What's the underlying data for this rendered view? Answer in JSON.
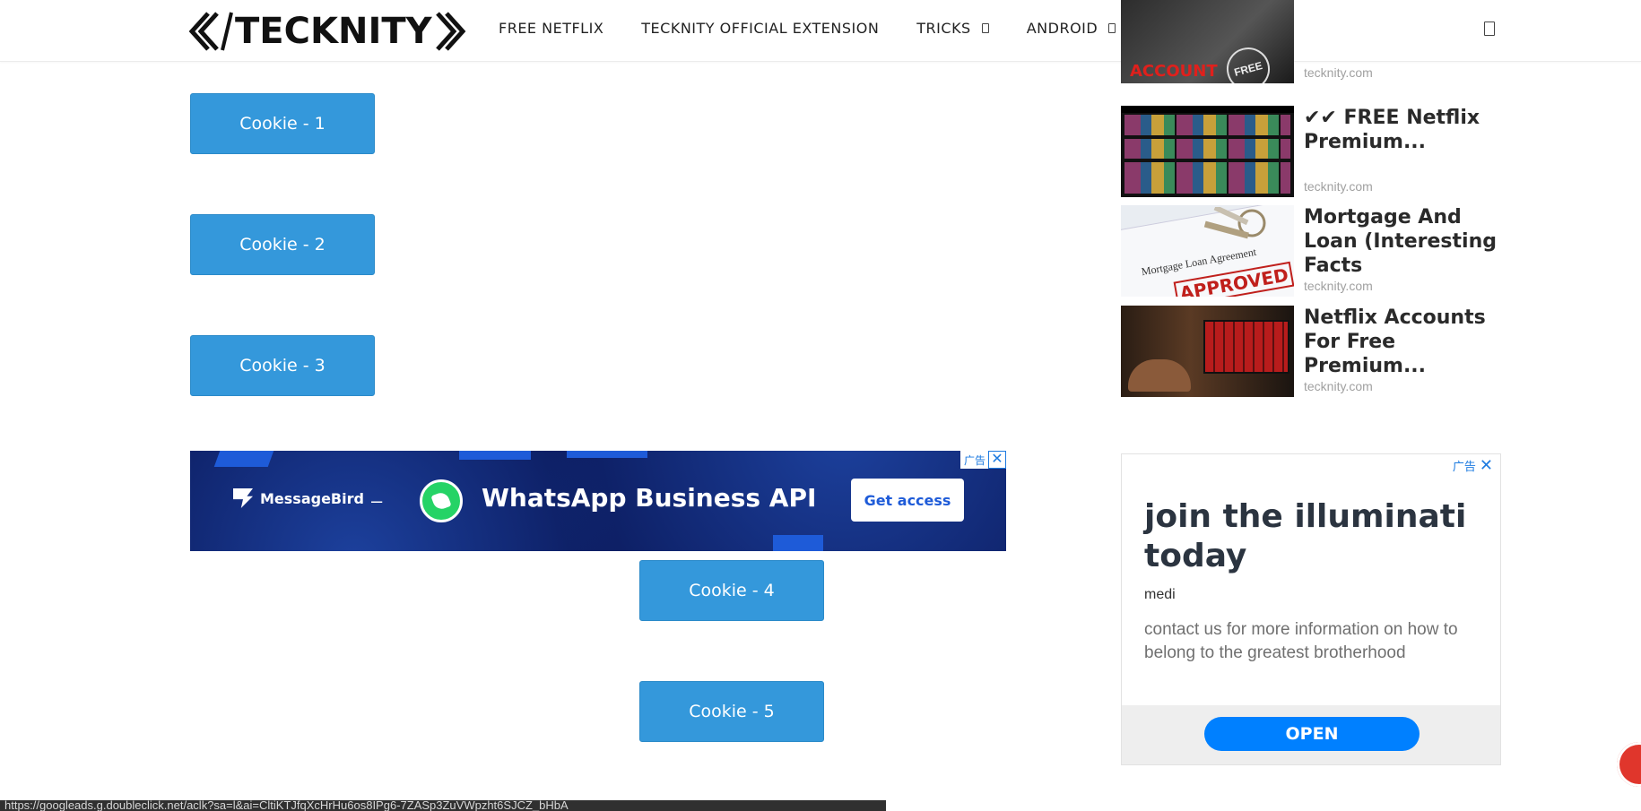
{
  "header": {
    "logo_text": "TECKNITY",
    "nav": [
      {
        "label": "FREE NETFLIX",
        "has_dropdown": false
      },
      {
        "label": "TECKNITY OFFICIAL EXTENSION",
        "has_dropdown": false
      },
      {
        "label": "TRICKS",
        "has_dropdown": true
      },
      {
        "label": "ANDROID",
        "has_dropdown": true
      }
    ]
  },
  "buttons": {
    "cookie1": "Cookie - 1",
    "cookie2": "Cookie - 2",
    "cookie3": "Cookie - 3",
    "cookie4": "Cookie - 4",
    "cookie5": "Cookie - 5"
  },
  "banner_ad": {
    "brand": "MessageBird",
    "dash": "–",
    "headline": "WhatsApp Business API",
    "cta": "Get access",
    "ad_label": "广告",
    "close": "✕"
  },
  "sidebar": {
    "items": [
      {
        "title": "",
        "source": "tecknity.com",
        "thumb_text": "ACCOUNT"
      },
      {
        "title": "✔✔ FREE Netflix Premium...",
        "source": "tecknity.com"
      },
      {
        "title": "Mortgage And Loan (Interesting Facts",
        "source": "tecknity.com",
        "thumb_text": "Mortgage Loan Agreement",
        "stamp": "APPROVED"
      },
      {
        "title": "Netflix Accounts For Free Premium...",
        "source": "tecknity.com"
      }
    ],
    "thumb_first_badge": "FREE",
    "ad": {
      "ad_label": "广告",
      "close": "✕",
      "headline": "join the illuminati today",
      "advertiser": "medi",
      "body": "contact us for more information on how to belong to the greatest brotherhood",
      "cta": "OPEN"
    }
  },
  "status_bar": {
    "url": "https://googleads.g.doubleclick.net/aclk?sa=l&ai=CltiKTJfqXcHrHu6os8IPg6-7ZASp3ZuVWpzht6SJCZ_bHbA"
  },
  "colors": {
    "accent": "#3498db",
    "banner_bg": "#0b1a5c",
    "open_button": "#0080ff"
  }
}
